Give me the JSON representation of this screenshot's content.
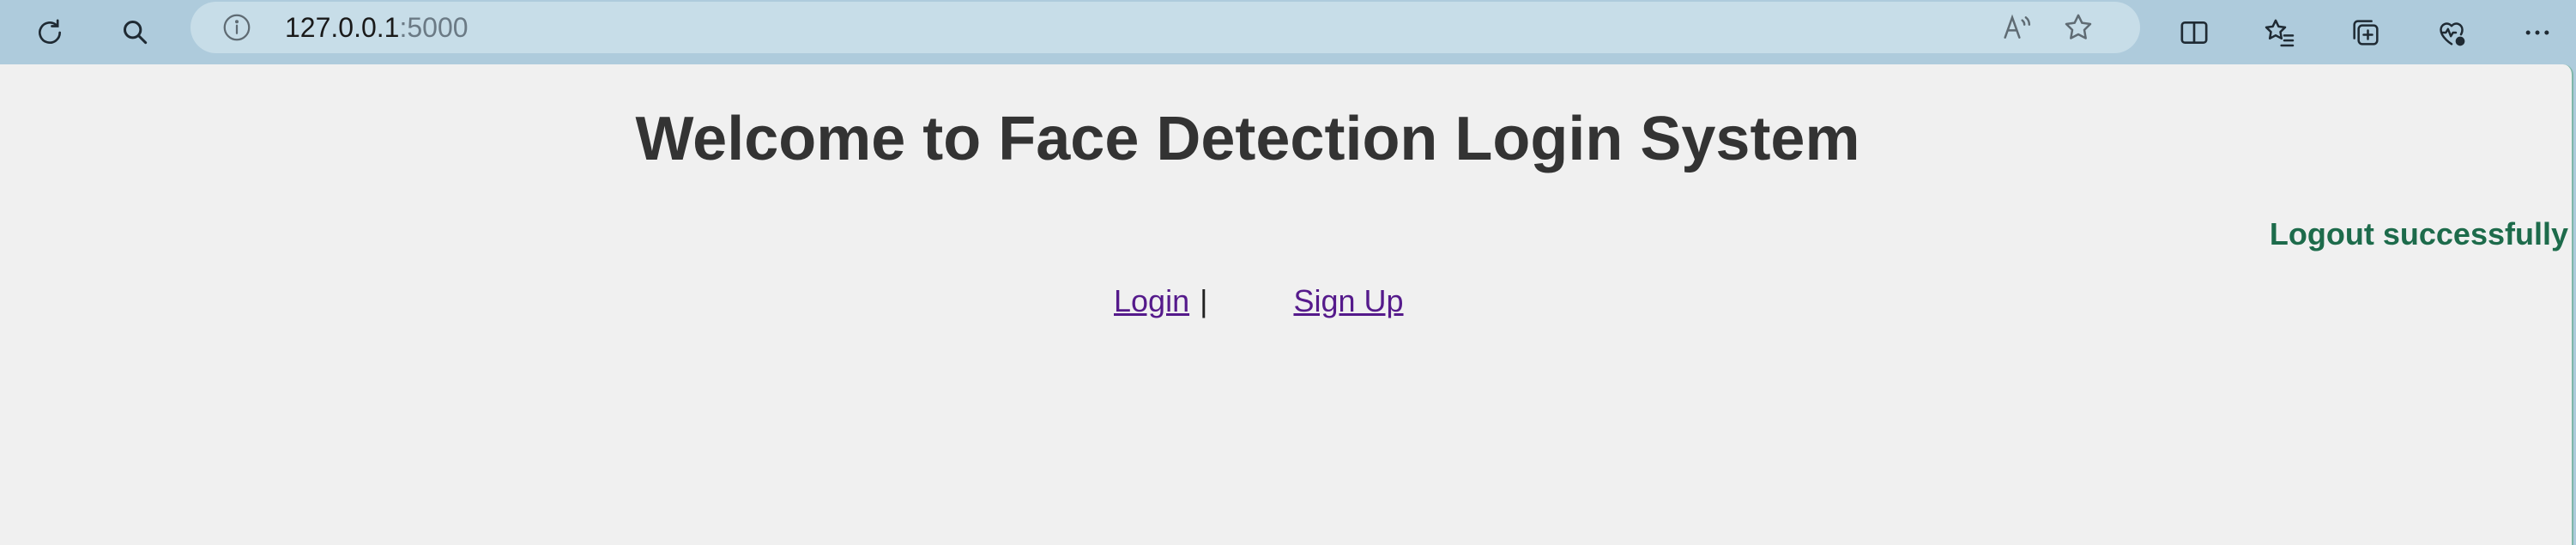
{
  "browser": {
    "url_host": "127.0.0.1",
    "url_port": ":5000",
    "icons": {
      "refresh": "refresh-icon",
      "search": "search-icon",
      "info": "info-icon",
      "read_aloud": "read-aloud-icon",
      "favorite": "star-icon",
      "split_screen": "split-screen-icon",
      "favorites": "favorites-icon",
      "collections": "collections-icon",
      "browser_essentials": "heart-pulse-icon",
      "more": "more-icon"
    }
  },
  "page": {
    "title": "Welcome to Face Detection Login System",
    "flash_message": "Logout successfully",
    "flash_color": "#1d6b4b",
    "nav": {
      "login_label": "Login",
      "separator": "|",
      "signup_label": "Sign Up"
    },
    "link_color": "#551a8b",
    "background": "#f0f0f0"
  }
}
